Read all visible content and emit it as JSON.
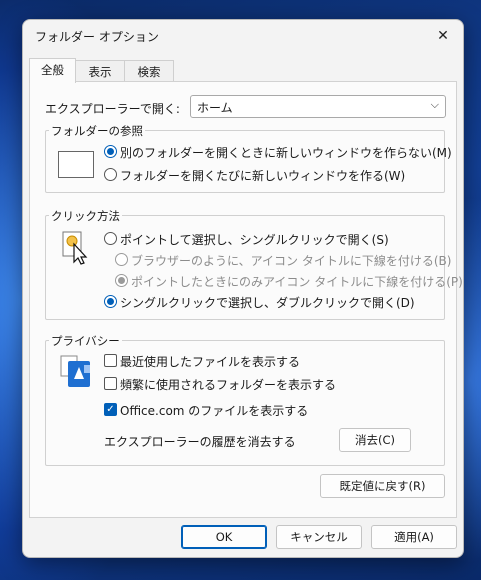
{
  "dialog": {
    "title": "フォルダー オプション",
    "close_glyph": "✕"
  },
  "tabs": [
    {
      "label": "全般",
      "active": true
    },
    {
      "label": "表示",
      "active": false
    },
    {
      "label": "検索",
      "active": false
    }
  ],
  "general": {
    "open_explorer_label": "エクスプローラーで開く:",
    "open_explorer_value": "ホーム",
    "browse": {
      "label": "フォルダーの参照",
      "options": [
        {
          "label": "別のフォルダーを開くときに新しいウィンドウを作らない(M)",
          "checked": true
        },
        {
          "label": "フォルダーを開くたびに新しいウィンドウを作る(W)",
          "checked": false
        }
      ]
    },
    "click": {
      "label": "クリック方法",
      "options": [
        {
          "label": "ポイントして選択し、シングルクリックで開く(S)",
          "checked": false
        },
        {
          "label": "ブラウザーのように、アイコン タイトルに下線を付ける(B)",
          "checked": false,
          "disabled": true
        },
        {
          "label": "ポイントしたときにのみアイコン タイトルに下線を付ける(P)",
          "checked": true,
          "disabled": true
        },
        {
          "label": "シングルクリックで選択し、ダブルクリックで開く(D)",
          "checked": true
        }
      ]
    },
    "privacy": {
      "label": "プライバシー",
      "checks": [
        {
          "label": "最近使用したファイルを表示する",
          "checked": false
        },
        {
          "label": "頻繁に使用されるフォルダーを表示する",
          "checked": false
        },
        {
          "label": "Office.com のファイルを表示する",
          "checked": true
        }
      ],
      "clear_history_label": "エクスプローラーの履歴を消去する",
      "clear_button": "消去(C)"
    },
    "restore_defaults": "既定値に戻す(R)"
  },
  "footer": {
    "ok": "OK",
    "cancel": "キャンセル",
    "apply": "適用(A)"
  },
  "colors": {
    "accent": "#005fb8",
    "dialog_bg": "#f3f3f3"
  }
}
